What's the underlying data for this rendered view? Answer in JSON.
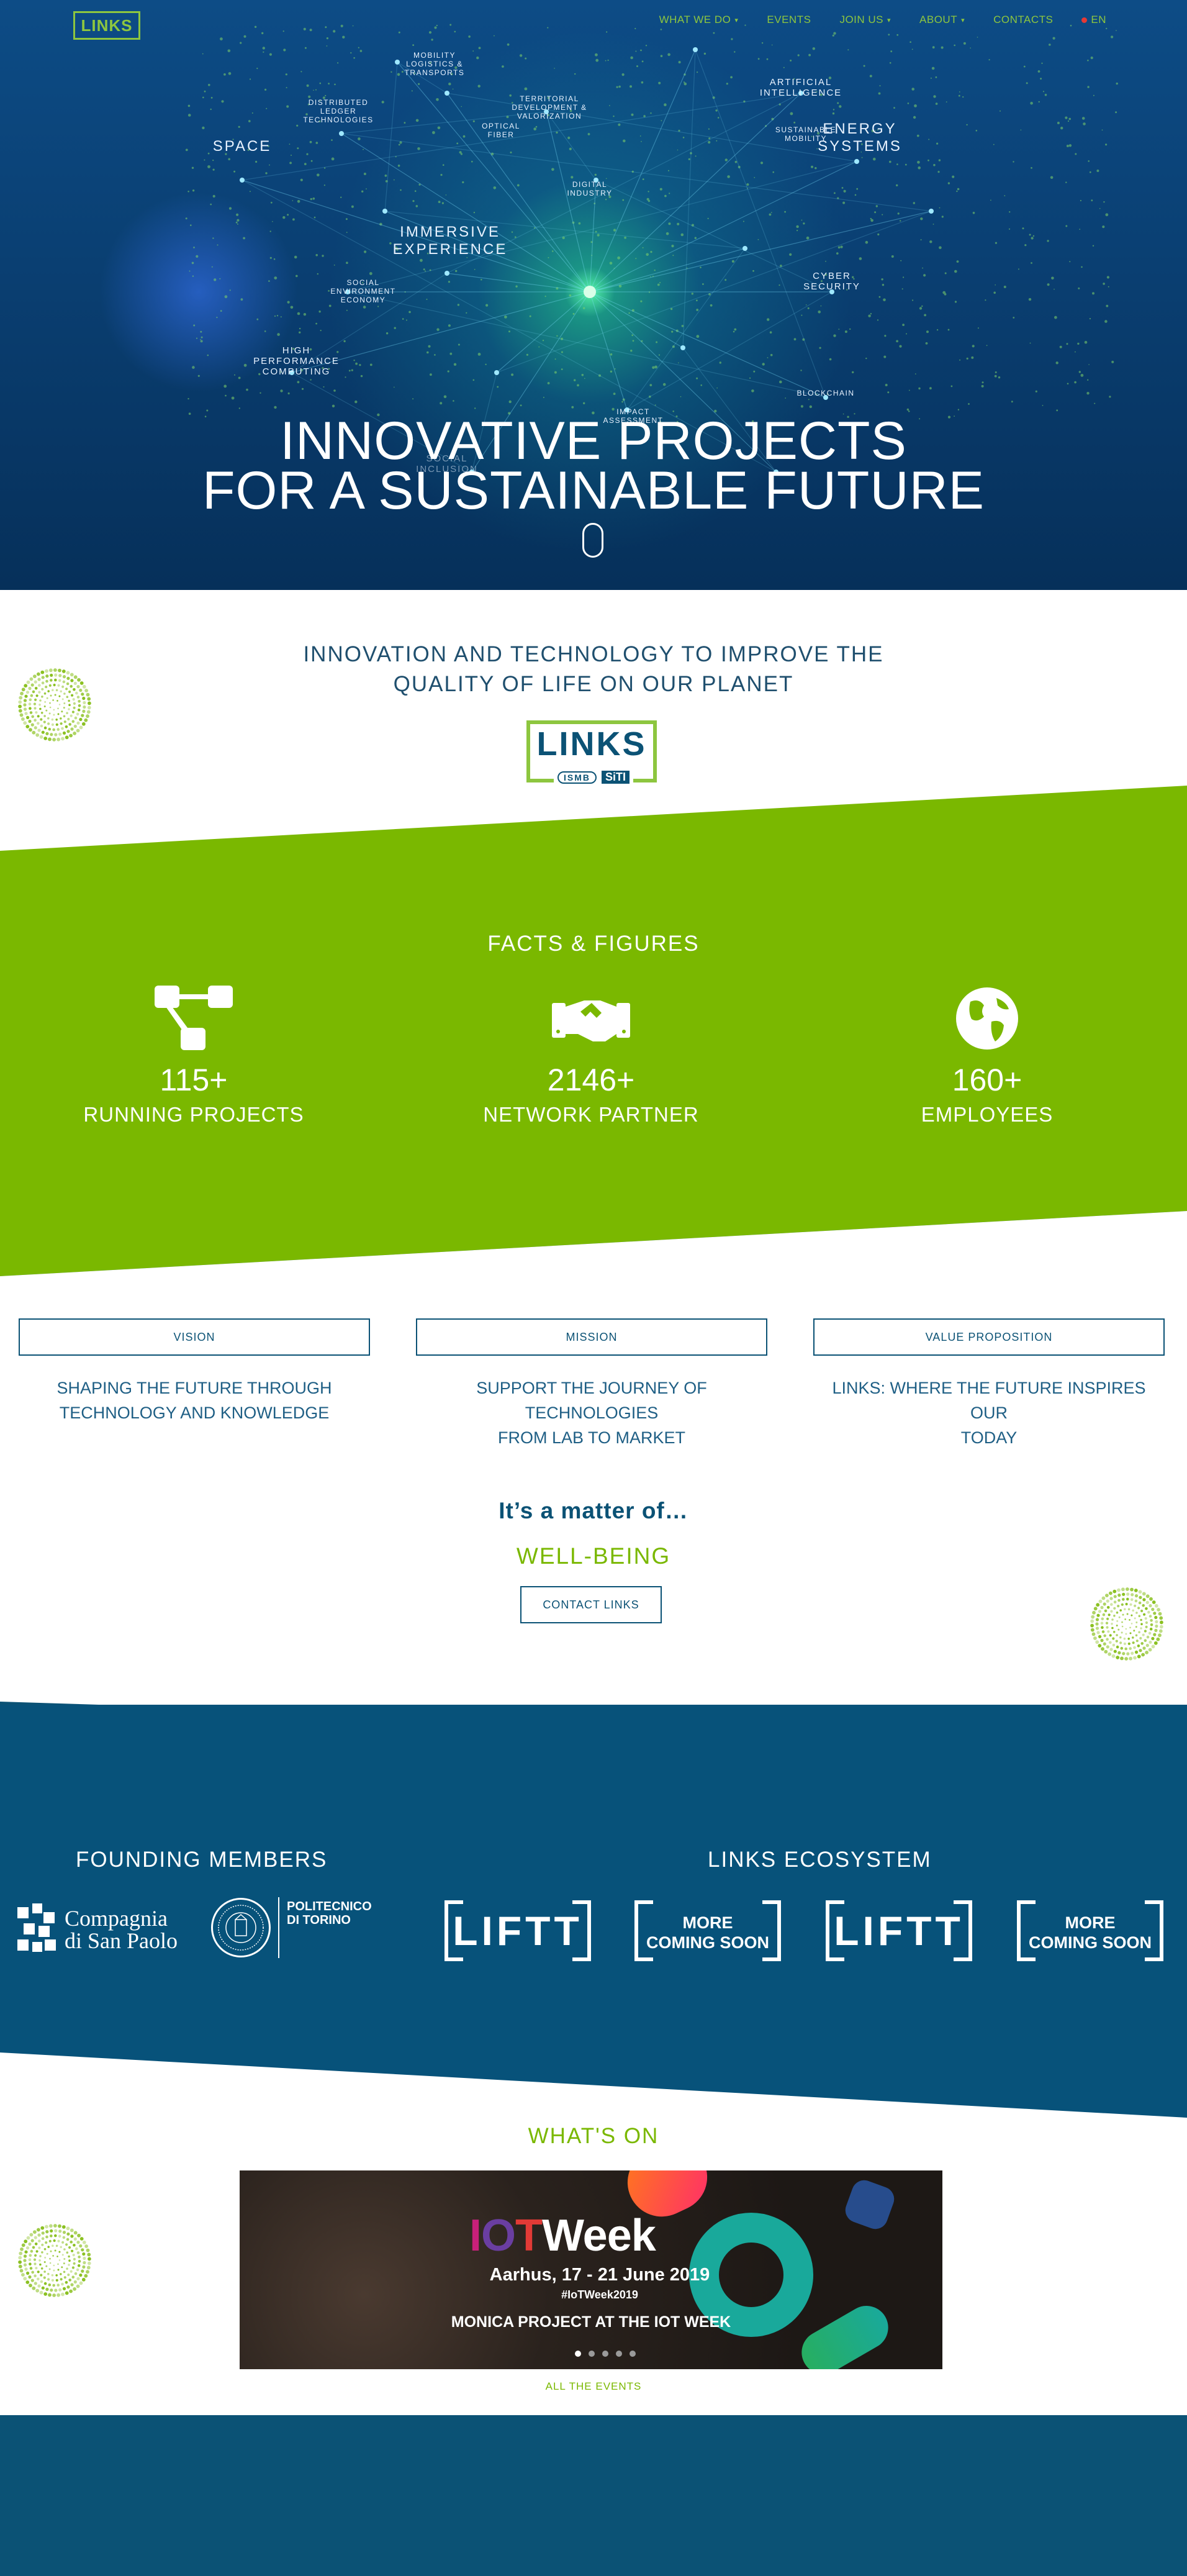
{
  "header": {
    "logo_text": "LINKS",
    "nav": [
      {
        "label": "WHAT WE DO",
        "dropdown": true
      },
      {
        "label": "EVENTS",
        "dropdown": false
      },
      {
        "label": "JOIN US",
        "dropdown": true
      },
      {
        "label": "ABOUT",
        "dropdown": true
      },
      {
        "label": "CONTACTS",
        "dropdown": false
      },
      {
        "label": "EN",
        "dropdown": false
      }
    ]
  },
  "hero": {
    "labels": {
      "mobility": "MOBILITY LOGISTICS & TRANSPORTS",
      "dlt": "DISTRIBUTED LEDGER TECHNOLOGIES",
      "space": "SPACE",
      "territorial": "TERRITORIAL DEVELOPMENT & VALORIZATION",
      "optical": "OPTICAL FIBER",
      "ai": "ARTIFICIAL INTELLIGENCE",
      "sustainable": "SUSTAINABLE MOBILITY",
      "energy": "ENERGY SYSTEMS",
      "digital": "DIGITAL INDUSTRY",
      "immersive": "IMMERSIVE EXPERIENCE",
      "social_env": "SOCIAL ENVIRONMENT ECONOMY",
      "cyber": "CYBER SECURITY",
      "hpc": "HIGH PERFORMANCE COMPUTING",
      "blockchain": "BLOCKCHAIN",
      "impact": "IMPACT ASSESSMENT",
      "social_incl": "SOCIAL INCLUSION"
    },
    "title_line1": "INNOVATIVE PROJECTS",
    "title_line2": "FOR A SUSTAINABLE FUTURE"
  },
  "intro": {
    "line1": "INNOVATION AND TECHNOLOGY TO IMPROVE THE",
    "line2": "QUALITY OF LIFE ON OUR PLANET",
    "logo_word": "LINKS",
    "logo_ismb": "ISMB",
    "logo_siti": "SiTI"
  },
  "facts": {
    "title": "FACTS & FIGURES",
    "items": [
      {
        "value": "115+",
        "label": "RUNNING PROJECTS",
        "icon": "sitemap-icon"
      },
      {
        "value": "2146+",
        "label": "NETWORK PARTNER",
        "icon": "handshake-icon"
      },
      {
        "value": "160+",
        "label": "EMPLOYEES",
        "icon": "globe-icon"
      }
    ]
  },
  "vision": {
    "items": [
      {
        "button": "VISION",
        "text_line1": "SHAPING THE FUTURE THROUGH",
        "text_line2": "TECHNOLOGY AND KNOWLEDGE"
      },
      {
        "button": "MISSION",
        "text_line1": "SUPPORT THE JOURNEY OF TECHNOLOGIES",
        "text_line2": "FROM LAB TO MARKET"
      },
      {
        "button": "VALUE PROPOSITION",
        "text_line1": "LINKS: WHERE THE FUTURE INSPIRES OUR",
        "text_line2": "TODAY"
      }
    ],
    "matter": "It’s a matter of…",
    "rotating_word": "WELL-BEING",
    "contact_button": "CONTACT LINKS"
  },
  "members": {
    "founding_title": "FOUNDING MEMBERS",
    "ecosystem_title": "LINKS ECOSYSTEM",
    "csp_line1": "Compagnia",
    "csp_line2": "di San Paolo",
    "polito_line1": "POLITECNICO",
    "polito_line2": "DI TORINO",
    "ecosystem": [
      {
        "type": "logo",
        "text": "LIFTT"
      },
      {
        "type": "text",
        "line1": "MORE",
        "line2": "COMING SOON"
      },
      {
        "type": "logo",
        "text": "LIFTT"
      },
      {
        "type": "text",
        "line1": "MORE",
        "line2": "COMING SOON"
      }
    ]
  },
  "whatson": {
    "title": "WHAT'S ON",
    "event": {
      "brand_i": "I",
      "brand_o": "O",
      "brand_t": "T",
      "brand_week": "Week",
      "date": "Aarhus, 17 - 21 June 2019",
      "hashtag": "#IoTWeek2019",
      "caption": "MONICA PROJECT AT THE IOT WEEK"
    },
    "all_events": "ALL THE EVENTS"
  },
  "colors": {
    "brand_blue": "#0b5275",
    "brand_green": "#7ab800",
    "nav_green": "#8dc63f"
  }
}
